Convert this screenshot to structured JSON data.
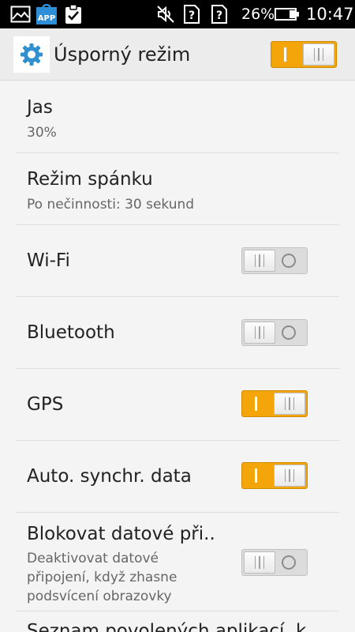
{
  "status_bar": {
    "icons": [
      "gallery-icon",
      "app-store-icon",
      "clipboard-check-icon",
      "muted-icon",
      "unknown-sim-icon",
      "unknown-sim-icon",
      "battery-icon"
    ],
    "app_badge": "APP",
    "battery_percent": "26%",
    "time": "10:47"
  },
  "header": {
    "icon": "gear-icon",
    "title": "Úsporný režim",
    "toggle_on": true,
    "accent": "#f4a50a"
  },
  "settings": [
    {
      "title": "Jas",
      "subtitle": "30%"
    },
    {
      "title": "Režim spánku",
      "subtitle": "Po nečinnosti: 30 sekund"
    },
    {
      "title": "Wi-Fi",
      "toggle_on": false
    },
    {
      "title": "Bluetooth",
      "toggle_on": false
    },
    {
      "title": "GPS",
      "toggle_on": true
    },
    {
      "title": "Auto. synchr. data",
      "toggle_on": true
    },
    {
      "title": "Blokovat datové při..",
      "subtitle": "Deaktivovat datové připojení, když zhasne podsvícení obrazovky",
      "toggle_on": false
    },
    {
      "title": "Seznam povolených aplikací, k"
    }
  ]
}
